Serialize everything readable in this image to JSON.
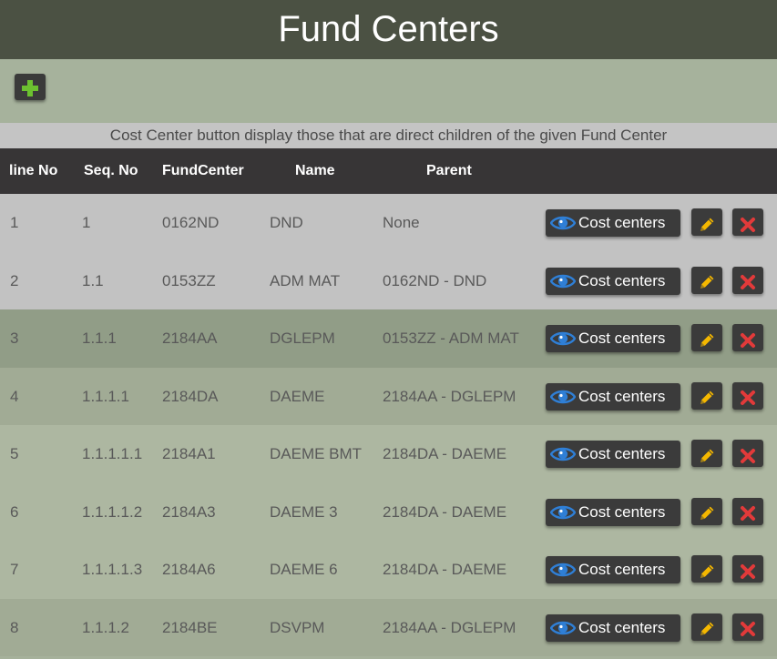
{
  "page": {
    "title": "Fund Centers"
  },
  "toolbar": {
    "add_icon": "plus-icon"
  },
  "note": "Cost Center button display those that are direct children of the given Fund Center",
  "table": {
    "headers": [
      "line No",
      "Seq. No",
      "FundCenter",
      "Name",
      "Parent"
    ],
    "cost_centers_label": "Cost centers",
    "rows": [
      {
        "line": "1",
        "seq": "1",
        "fund_center": "0162ND",
        "name": "DND",
        "parent": "None",
        "bg": "#c2c2c2"
      },
      {
        "line": "2",
        "seq": "1.1",
        "fund_center": "0153ZZ",
        "name": "ADM MAT",
        "parent": "0162ND - DND",
        "bg": "#c2c2c2"
      },
      {
        "line": "3",
        "seq": "1.1.1",
        "fund_center": "2184AA",
        "name": "DGLEPM",
        "parent": "0153ZZ - ADM MAT",
        "bg": "#919d87"
      },
      {
        "line": "4",
        "seq": "1.1.1.1",
        "fund_center": "2184DA",
        "name": "DAEME",
        "parent": "2184AA - DGLEPM",
        "bg": "#a1ab95"
      },
      {
        "line": "5",
        "seq": "1.1.1.1.1",
        "fund_center": "2184A1",
        "name": "DAEME BMT",
        "parent": "2184DA - DAEME",
        "bg": "#adb7a1"
      },
      {
        "line": "6",
        "seq": "1.1.1.1.2",
        "fund_center": "2184A3",
        "name": "DAEME 3",
        "parent": "2184DA - DAEME",
        "bg": "#adb7a1"
      },
      {
        "line": "7",
        "seq": "1.1.1.1.3",
        "fund_center": "2184A6",
        "name": "DAEME 6",
        "parent": "2184DA - DAEME",
        "bg": "#adb7a1"
      },
      {
        "line": "8",
        "seq": "1.1.1.2",
        "fund_center": "2184BE",
        "name": "DSVPM",
        "parent": "2184AA - DGLEPM",
        "bg": "#a1ab95"
      }
    ]
  },
  "colors": {
    "header_bg": "#4b5143",
    "toolbar_bg": "#a6b29c",
    "table_header_bg": "#373536",
    "plus_green": "#6cc130",
    "eye_blue": "#2f7fd6",
    "pencil_yellow": "#f5b800",
    "delete_red": "#e23a3a"
  },
  "icons": {
    "view": "eye-icon",
    "edit": "pencil-icon",
    "delete": "close-icon"
  }
}
